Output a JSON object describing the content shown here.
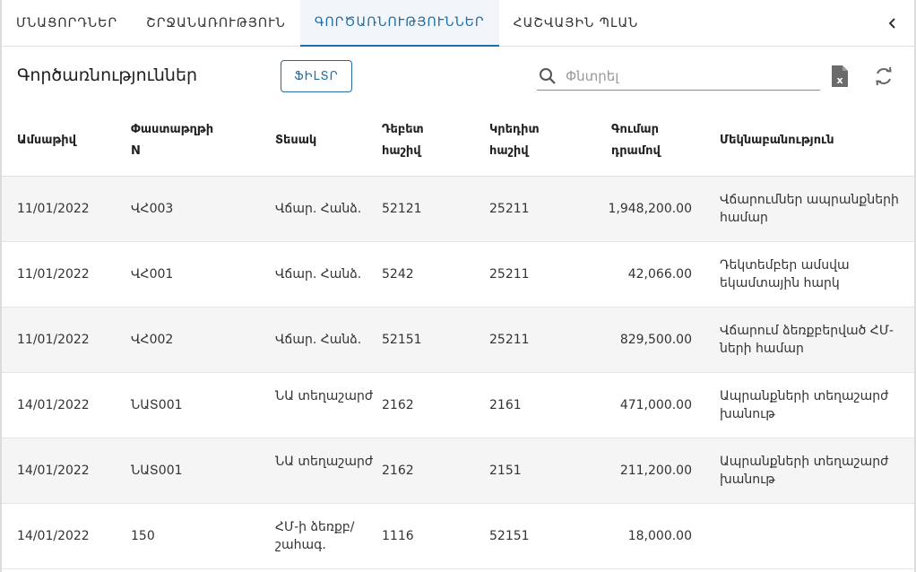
{
  "tabs": [
    {
      "label": "ՄՆԱՑՈՐԴՆԵՐ",
      "active": false
    },
    {
      "label": "ՇՐՋԱՆԱՌՈՒԹՅՈՒՆ",
      "active": false
    },
    {
      "label": "ԳՈՐԾԱՌՆՈՒԹՅՈՒՆՆԵՐ",
      "active": true
    },
    {
      "label": "ՀԱՇՎԱՅԻՆ ՊԼԱՆ",
      "active": false
    }
  ],
  "toolbar": {
    "title": "Գործառնություններ",
    "filter_label": "ՖԻԼՏՐ",
    "search_placeholder": "Փնտրել"
  },
  "icons": {
    "collapse": "chevron-left-icon",
    "search": "search-icon",
    "excel": "excel-export-icon",
    "refresh": "refresh-icon"
  },
  "colors": {
    "accent": "#1f6da3",
    "row_alt": "#f5f5f5"
  },
  "table": {
    "columns": {
      "date": "Ամսաթիվ",
      "doc_line1": "Փաստաթղթի",
      "doc_line2": "N",
      "type": "Տեսակ",
      "debit_line1": "Դեբետ",
      "debit_line2": "հաշիվ",
      "credit_line1": "Կրեդիտ",
      "credit_line2": "հաշիվ",
      "amount_line1": "Գումար",
      "amount_line2": "դրամով",
      "description": "Մեկնաբանություն"
    },
    "rows": [
      {
        "date": "11/01/2022",
        "doc": "ՎՀ003",
        "type": "Վճար. Հանձ.",
        "debit": "52121",
        "credit": "25211",
        "amount": "1,948,200.00",
        "description": "Վճարումներ ապրանքների համար"
      },
      {
        "date": "11/01/2022",
        "doc": "ՎՀ001",
        "type": "Վճար. Հանձ.",
        "debit": "5242",
        "credit": "25211",
        "amount": "42,066.00",
        "description": "Դեկտեմբեր ամսվա եկամտային հարկ"
      },
      {
        "date": "11/01/2022",
        "doc": "ՎՀ002",
        "type": "Վճար. Հանձ.",
        "debit": "52151",
        "credit": "25211",
        "amount": "829,500.00",
        "description": "Վճարում ձեռքբերված ՀՄ-ների համար"
      },
      {
        "date": "14/01/2022",
        "doc": "ՆԱՏ001",
        "type": "ՆԱ տեղաշարժ",
        "debit": "2162",
        "credit": "2161",
        "amount": "471,000.00",
        "description": "Ապրանքների տեղաշարժ խանութ"
      },
      {
        "date": "14/01/2022",
        "doc": "ՆԱՏ001",
        "type": "ՆԱ տեղաշարժ",
        "debit": "2162",
        "credit": "2151",
        "amount": "211,200.00",
        "description": "Ապրանքների տեղաշարժ խանութ"
      },
      {
        "date": "14/01/2022",
        "doc": "150",
        "type": "ՀՄ-ի ձեռքբ/ շահագ.",
        "debit": "1116",
        "credit": "52151",
        "amount": "18,000.00",
        "description": ""
      }
    ]
  }
}
